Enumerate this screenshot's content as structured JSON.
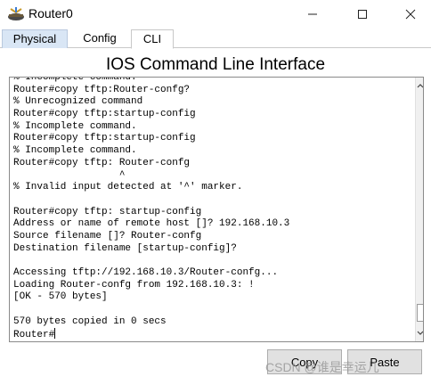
{
  "window": {
    "title": "Router0"
  },
  "tabs": [
    {
      "label": "Physical"
    },
    {
      "label": "Config"
    },
    {
      "label": "CLI"
    }
  ],
  "cli": {
    "header": "IOS Command Line Interface",
    "lines": [
      "% Incomplete command.",
      "Router#copy tftp:Router-confg?",
      "% Unrecognized command",
      "Router#copy tftp:startup-config",
      "% Incomplete command.",
      "Router#copy tftp:startup-config",
      "% Incomplete command.",
      "Router#copy tftp: Router-confg",
      "                  ^",
      "% Invalid input detected at '^' marker.",
      "",
      "Router#copy tftp: startup-config",
      "Address or name of remote host []? 192.168.10.3",
      "Source filename []? Router-confg",
      "Destination filename [startup-config]?",
      "",
      "Accessing tftp://192.168.10.3/Router-confg...",
      "Loading Router-confg from 192.168.10.3: !",
      "[OK - 570 bytes]",
      "",
      "570 bytes copied in 0 secs",
      "Router#"
    ]
  },
  "buttons": {
    "copy": "Copy",
    "paste": "Paste"
  },
  "watermark": "CSDN @谁是幸运儿"
}
